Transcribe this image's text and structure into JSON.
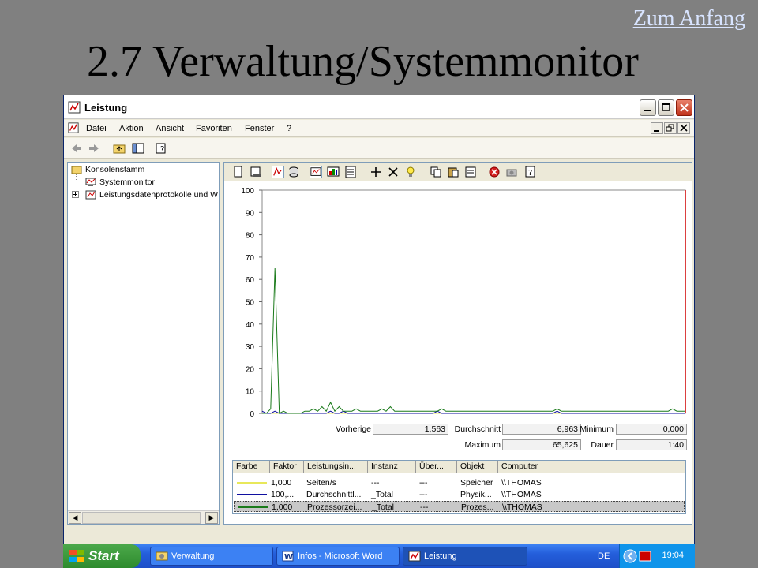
{
  "slide": {
    "top_link": "Zum Anfang",
    "title": "2.7 Verwaltung/Systemmonitor"
  },
  "window": {
    "title": "Leistung",
    "menu": [
      "Datei",
      "Aktion",
      "Ansicht",
      "Favoriten",
      "Fenster",
      "?"
    ]
  },
  "tree": {
    "root": "Konsolenstamm",
    "items": [
      "Systemmonitor",
      "Leistungsdatenprotokolle und W"
    ]
  },
  "chart_data": {
    "type": "line",
    "ylim": [
      0,
      100
    ],
    "yticks": [
      0,
      10,
      20,
      30,
      40,
      50,
      60,
      70,
      80,
      90,
      100
    ],
    "current_marker_index": 99,
    "series": [
      {
        "color": "#e8e85a",
        "values": [
          0,
          0,
          0,
          0,
          0,
          0,
          0,
          0,
          0,
          0,
          0,
          0,
          0,
          0,
          0,
          0,
          0,
          0,
          0,
          0,
          0,
          0,
          0,
          0,
          0,
          0,
          0,
          0,
          0,
          0,
          0,
          0,
          0,
          0,
          0,
          0,
          0,
          0,
          0,
          0,
          0,
          0,
          0,
          0,
          0,
          0,
          0,
          0,
          0,
          0,
          0,
          0,
          0,
          0,
          0,
          0,
          0,
          0,
          0,
          0,
          0,
          0,
          0,
          0,
          0,
          0,
          0,
          0,
          0,
          0,
          0,
          0,
          0,
          0,
          0,
          0,
          0,
          0,
          0,
          0,
          0,
          0,
          0,
          0,
          0,
          0,
          0,
          0,
          0,
          0,
          0,
          0,
          0,
          0,
          0,
          0,
          0,
          0,
          0,
          0
        ]
      },
      {
        "color": "#1010a0",
        "values": [
          1,
          0,
          0,
          1,
          0,
          0,
          0,
          0,
          0,
          0,
          0,
          0,
          0,
          0,
          0,
          0,
          1,
          0,
          0,
          1,
          0,
          0,
          0,
          0,
          0,
          0,
          0,
          0,
          0,
          0,
          0,
          0,
          0,
          0,
          0,
          0,
          0,
          0,
          0,
          0,
          0,
          1,
          0,
          0,
          0,
          0,
          0,
          0,
          0,
          0,
          0,
          0,
          0,
          0,
          0,
          0,
          0,
          0,
          0,
          0,
          0,
          0,
          0,
          0,
          0,
          0,
          0,
          0,
          0,
          1,
          0,
          0,
          0,
          0,
          0,
          0,
          0,
          0,
          0,
          0,
          0,
          0,
          0,
          0,
          0,
          0,
          0,
          0,
          0,
          0,
          0,
          0,
          0,
          0,
          0,
          0,
          0,
          0,
          0,
          0
        ]
      },
      {
        "color": "#1a7a1a",
        "values": [
          0,
          0,
          2,
          65,
          0,
          1,
          0,
          0,
          0,
          0,
          1,
          1,
          2,
          1,
          3,
          1,
          5,
          1,
          3,
          1,
          1,
          1,
          2,
          1,
          1,
          1,
          1,
          1,
          2,
          1,
          3,
          1,
          1,
          1,
          1,
          1,
          1,
          1,
          1,
          1,
          1,
          1,
          2,
          1,
          1,
          1,
          1,
          1,
          1,
          1,
          1,
          1,
          1,
          1,
          1,
          1,
          1,
          1,
          1,
          1,
          1,
          1,
          1,
          1,
          1,
          1,
          1,
          1,
          1,
          2,
          1,
          1,
          1,
          1,
          1,
          1,
          1,
          1,
          1,
          1,
          1,
          1,
          1,
          1,
          1,
          1,
          1,
          1,
          1,
          1,
          1,
          1,
          1,
          1,
          1,
          1,
          2,
          1,
          1,
          1
        ]
      }
    ]
  },
  "stats": {
    "last_label": "Vorherige",
    "last_value": "1,563",
    "avg_label": "Durchschnitt",
    "avg_value": "6,963",
    "min_label": "Minimum",
    "min_value": "0,000",
    "max_label": "Maximum",
    "max_value": "65,625",
    "dur_label": "Dauer",
    "dur_value": "1:40"
  },
  "legend": {
    "headers": [
      "Farbe",
      "Faktor",
      "Leistungsin...",
      "Instanz",
      "Über...",
      "Objekt",
      "Computer"
    ],
    "rows": [
      {
        "color": "#e8e85a",
        "factor": "1,000",
        "counter": "Seiten/s",
        "instance": "---",
        "parent": "---",
        "object": "Speicher",
        "computer": "\\\\THOMAS"
      },
      {
        "color": "#1010a0",
        "factor": "100,...",
        "counter": "Durchschnittl...",
        "instance": "_Total",
        "parent": "---",
        "object": "Physik...",
        "computer": "\\\\THOMAS"
      },
      {
        "color": "#1a7a1a",
        "factor": "1,000",
        "counter": "Prozessorzei...",
        "instance": "_Total",
        "parent": "---",
        "object": "Prozes...",
        "computer": "\\\\THOMAS"
      }
    ]
  },
  "taskbar": {
    "start": "Start",
    "tasks": [
      "Verwaltung",
      "Infos - Microsoft Word",
      "Leistung"
    ],
    "lang": "DE",
    "clock": "19:04"
  }
}
